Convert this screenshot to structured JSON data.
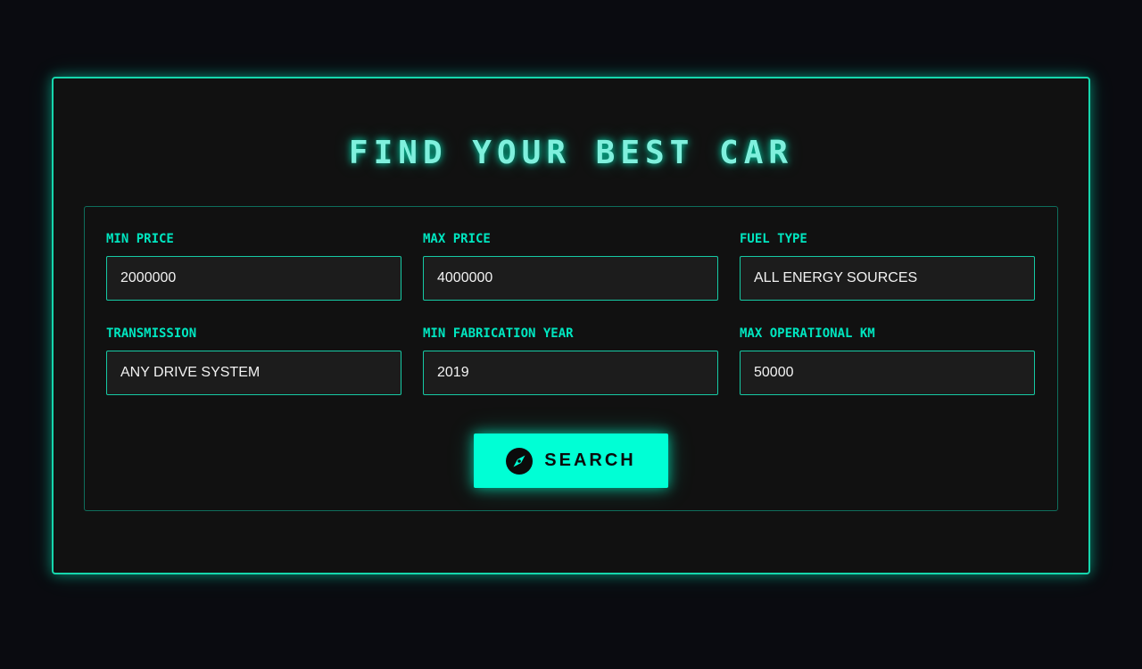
{
  "title": "FIND YOUR BEST CAR",
  "fields": [
    {
      "label": "MIN PRICE",
      "value": "2000000"
    },
    {
      "label": "MAX PRICE",
      "value": "4000000"
    },
    {
      "label": "FUEL TYPE",
      "value": "ALL ENERGY SOURCES"
    },
    {
      "label": "TRANSMISSION",
      "value": "ANY DRIVE SYSTEM"
    },
    {
      "label": "MIN FABRICATION YEAR",
      "value": "2019"
    },
    {
      "label": "MAX OPERATIONAL KM",
      "value": "50000"
    }
  ],
  "search_button": {
    "label": "SEARCH",
    "icon": "compass-icon"
  },
  "colors": {
    "accent": "#00ffd5",
    "label": "#00e6c0",
    "background": "#0a0b10",
    "panel": "#111111"
  }
}
